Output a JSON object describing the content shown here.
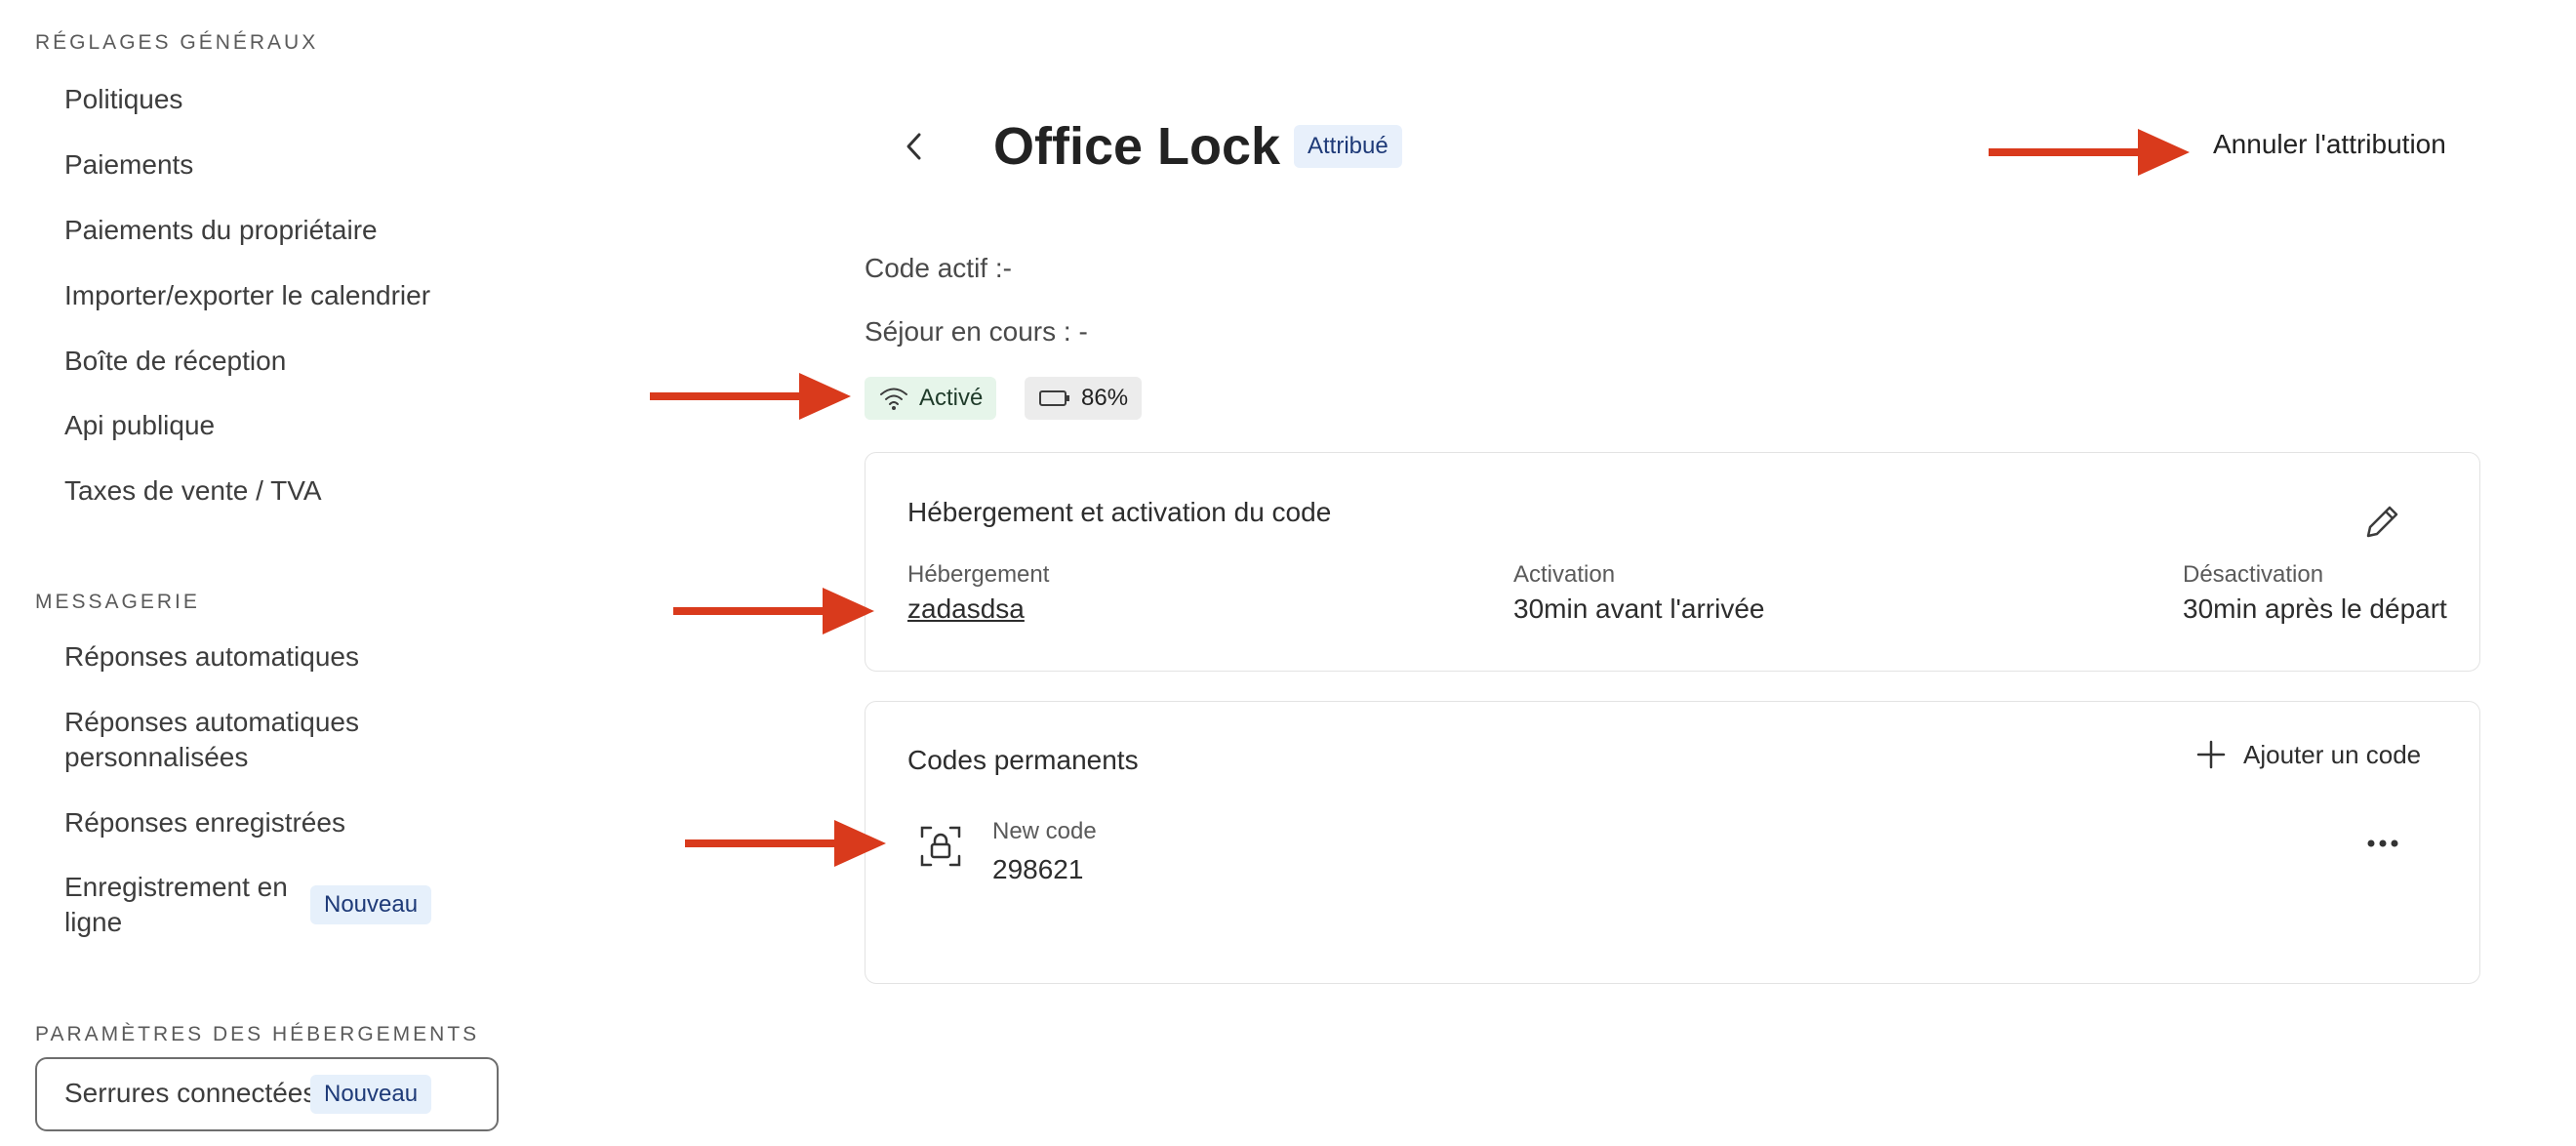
{
  "sidebar": {
    "general_title": "RÉGLAGES GÉNÉRAUX",
    "general_items": [
      "Politiques",
      "Paiements",
      "Paiements du propriétaire",
      "Importer/exporter le calendrier",
      "Boîte de réception",
      "Api publique",
      "Taxes de vente / TVA"
    ],
    "messaging_title": "MESSAGERIE",
    "messaging_items": [
      "Réponses automatiques",
      "Réponses automatiques personnalisées",
      "Réponses enregistrées",
      "Enregistrement en ligne"
    ],
    "new_badge": "Nouveau",
    "properties_title": "PARAMÈTRES DES HÉBERGEMENTS",
    "properties_items": [
      "Serrures connectées"
    ]
  },
  "header": {
    "title": "Office Lock",
    "status": "Attribué",
    "unassign_label": "Annuler l'attribution"
  },
  "info": {
    "active_code": "Code actif :-",
    "current_stay": "Séjour en cours : -"
  },
  "chips": {
    "connection": "Activé",
    "battery": "86%"
  },
  "hosting_card": {
    "title": "Hébergement et activation du code",
    "hosting_label": "Hébergement",
    "hosting_value": "zadasdsa",
    "activation_label": "Activation",
    "activation_value": "30min avant l'arrivée",
    "deactivation_label": "Désactivation",
    "deactivation_value": "30min après le départ"
  },
  "codes_card": {
    "title": "Codes permanents",
    "add_label": "Ajouter un code",
    "codes": [
      {
        "name": "New code",
        "value": "298621"
      }
    ]
  },
  "colors": {
    "accent_arrow": "#d93a1c",
    "badge_bg": "#e6f0fb",
    "badge_text": "#1e3a78",
    "active_chip_bg": "#e6f5ea"
  }
}
